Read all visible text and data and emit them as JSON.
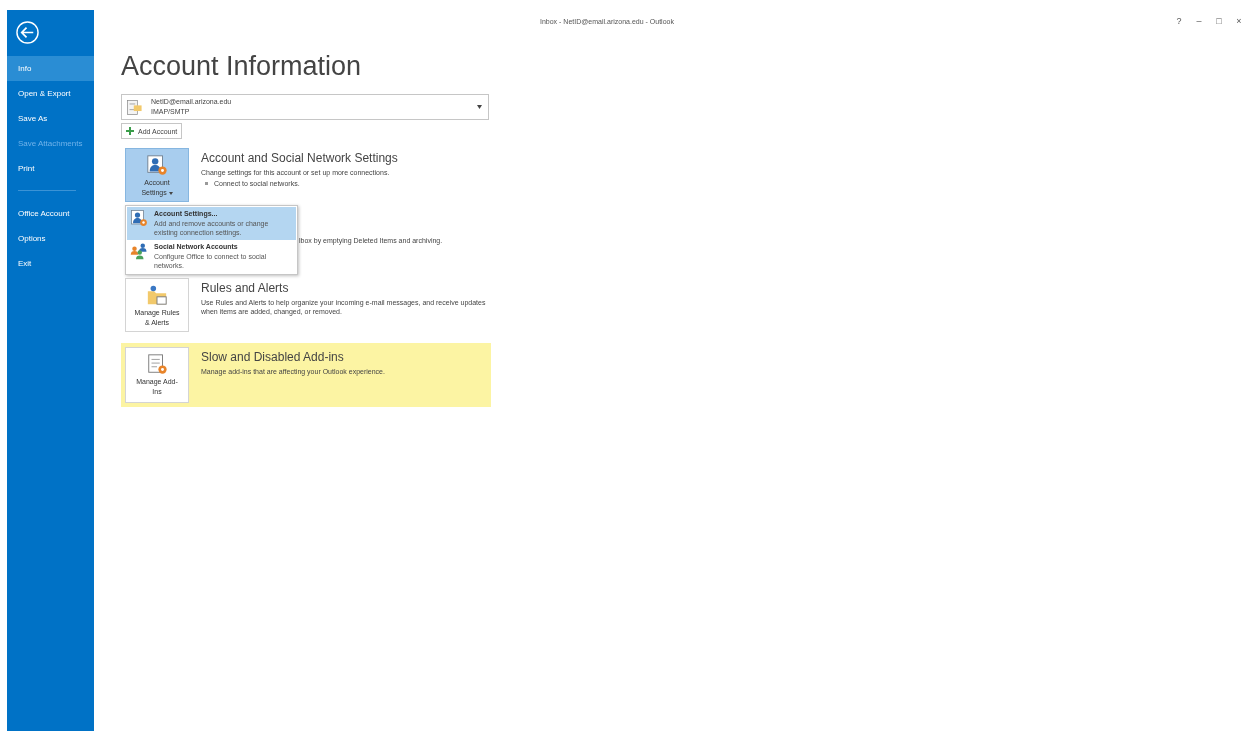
{
  "window": {
    "title": "Inbox - NetID@email.arizona.edu - Outlook",
    "controls": [
      "?",
      "–",
      "□",
      "×"
    ]
  },
  "sidebar": {
    "items": [
      {
        "kind": "item",
        "label": "Info",
        "selected": true,
        "disabled": false
      },
      {
        "kind": "item",
        "label": "Open & Export",
        "selected": false,
        "disabled": false
      },
      {
        "kind": "item",
        "label": "Save As",
        "selected": false,
        "disabled": false
      },
      {
        "kind": "item",
        "label": "Save Attachments",
        "selected": false,
        "disabled": true
      },
      {
        "kind": "item",
        "label": "Print",
        "selected": false,
        "disabled": false
      },
      {
        "kind": "separator"
      },
      {
        "kind": "item",
        "label": "Office Account",
        "selected": false,
        "disabled": false
      },
      {
        "kind": "item",
        "label": "Options",
        "selected": false,
        "disabled": false
      },
      {
        "kind": "item",
        "label": "Exit",
        "selected": false,
        "disabled": false
      }
    ]
  },
  "heading": "Account Information",
  "account": {
    "address": "NetID@email.arizona.edu",
    "type": "IMAP/SMTP"
  },
  "add_account": "Add Account",
  "sections": [
    {
      "kind": "button",
      "button_label": "Account Settings",
      "caret": true,
      "pressed": true,
      "highlight": false,
      "title": "Account and Social Network Settings",
      "description": "Change settings for this account or set up more connections.",
      "bullets": [
        "Connect to social networks."
      ]
    },
    {
      "kind": "covered",
      "description": "lbox by emptying Deleted Items and archiving."
    },
    {
      "kind": "button",
      "button_label": "Manage Rules & Alerts",
      "caret": false,
      "pressed": false,
      "highlight": false,
      "title": "Rules and Alerts",
      "description": "Use Rules and Alerts to help organize your incoming e-mail messages, and receive updates when items are added, changed, or removed."
    },
    {
      "kind": "button",
      "button_label": "Manage Add-Ins",
      "caret": false,
      "pressed": false,
      "highlight": true,
      "title": "Slow and Disabled Add-ins",
      "description": "Manage add-ins that are affecting your Outlook experience."
    }
  ],
  "menu": {
    "items": [
      {
        "title": "Account Settings...",
        "description": "Add and remove accounts or change existing connection settings.",
        "selected": true
      },
      {
        "title": "Social Network Accounts",
        "description": "Configure Office to connect to social networks.",
        "selected": false
      }
    ]
  }
}
